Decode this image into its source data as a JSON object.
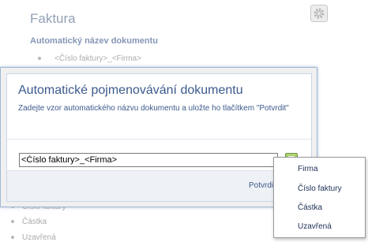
{
  "background": {
    "title": "Faktura",
    "section_title": "Automatický název dokumentu",
    "current_template": "<Číslo faktury>_<Firma>",
    "list_items": [
      "Číslo faktury",
      "Částka",
      "Uzavřená"
    ]
  },
  "dialog": {
    "title": "Automatické pojmenovávání dokumentu",
    "description": "Zadejte vzor automatického názvu dokumentu a uložte ho tlačítkem \"Potvrdit\"",
    "input_value": "<Číslo faktury>_<Firma>",
    "confirm_label": "Potvrdit"
  },
  "dropdown": {
    "items": [
      "Firma",
      "Číslo faktury",
      "Částka",
      "Uzavřená"
    ]
  },
  "colors": {
    "accent_text": "#3c5a8c",
    "dialog_border": "#9fb6d3",
    "button_green": "#7fae3e"
  },
  "icons": {
    "settings": "gear-icon",
    "field_picker": "list-icon"
  }
}
